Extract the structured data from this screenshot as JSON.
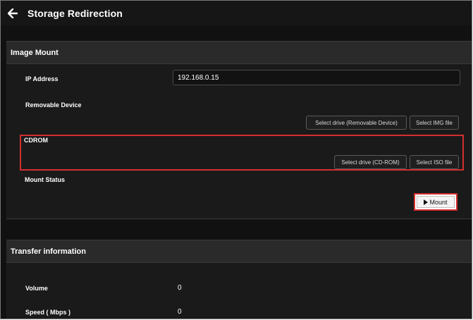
{
  "window": {
    "title": "Storage Redirection"
  },
  "image_mount": {
    "header": "Image Mount",
    "ip_label": "IP Address",
    "ip_value": "192.168.0.15",
    "removable_label": "Removable Device",
    "removable_drive_button": "Select drive (Removable Device)",
    "img_file_button": "Select IMG file",
    "cdrom_label": "CDROM",
    "cdrom_drive_button": "Select drive (CD-ROM)",
    "iso_file_button": "Select ISO file",
    "mount_status_label": "Mount Status",
    "mount_button": "Mount"
  },
  "transfer": {
    "header": "Transfer information",
    "volume_label": "Volume",
    "volume_value": "0",
    "speed_label": "Speed ( Mbps )",
    "speed_value": "0"
  },
  "colors": {
    "highlight": "#d32f2f",
    "background": "#111111",
    "panel": "#1a1a1a",
    "header": "#2a2a2a"
  }
}
